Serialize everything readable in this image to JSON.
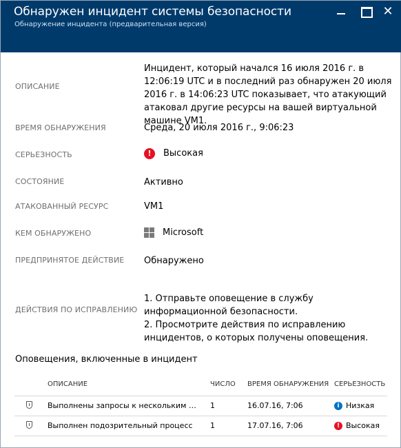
{
  "header": {
    "title": "Обнаружен инцидент системы безопасности",
    "subtitle": "Обнаружение инцидента (предварительная версия)",
    "close_glyph": "✕"
  },
  "fields": {
    "description": {
      "label": "ОПИСАНИЕ",
      "value": "Инцидент, который начался 16 июля 2016 г. в 12:06:19 UTC и в последний раз обнаружен 20 июля 2016 г. в 14:06:23 UTC показывает, что атакующий атаковал другие ресурсы на вашей виртуальной машине VM1."
    },
    "detection_time": {
      "label": "ВРЕМЯ ОБНАРУЖЕНИЯ",
      "value": "Среда, 20 июля 2016 г., 9:06:23"
    },
    "severity": {
      "label": "СЕРЬЕЗНОСТЬ",
      "value": "Высокая",
      "icon": "!"
    },
    "state": {
      "label": "СОСТОЯНИЕ",
      "value": "Активно"
    },
    "attacked_resource": {
      "label": "АТАКОВАННЫЙ РЕСУРС",
      "value": "VM1"
    },
    "detected_by": {
      "label": "КЕМ ОБНАРУЖЕНО",
      "value": "Microsoft"
    },
    "action_taken": {
      "label": "ПРЕДПРИНЯТОЕ ДЕЙСТВИЕ",
      "value": "Обнаружено"
    },
    "remediation": {
      "label": "ДЕЙСТВИЯ ПО ИСПРАВЛЕНИЮ",
      "step1": "1. Отправьте оповещение в службу информационной безопасности.",
      "step2": "2. Просмотрите действия по исправлению инцидентов, о которых получены оповещения."
    }
  },
  "alerts": {
    "title": "Оповещения, включенные в инцидент",
    "columns": [
      "ОПИСАНИЕ",
      "ЧИСЛО",
      "ВРЕМЯ ОБНАРУЖЕНИЯ",
      "СЕРЬЕЗНОСТЬ"
    ],
    "rows": [
      {
        "description": "Выполнены запросы к нескольким учетным записям",
        "count": "1",
        "time": "16.07.16, 7:06",
        "severity": "Низкая",
        "sev_icon": "i"
      },
      {
        "description": "Выполнен подозрительный процесс",
        "count": "1",
        "time": "17.07.16, 7:06",
        "severity": "Высокая",
        "sev_icon": "!"
      }
    ]
  },
  "colors": {
    "header_bg": "#003a6b",
    "severity_high": "#e81123",
    "severity_low": "#0072c6",
    "label_gray": "#6e6e6e"
  }
}
